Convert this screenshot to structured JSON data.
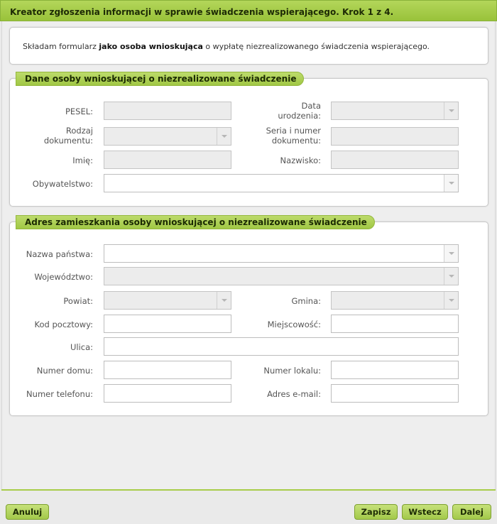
{
  "title": "Kreator zgłoszenia informacji w sprawie świadczenia wspierającego. Krok 1 z 4.",
  "intro": {
    "prefix": "Składam formularz ",
    "bold": "jako osoba wnioskująca",
    "suffix": " o wypłatę niezrealizowanego świadczenia wspierającego."
  },
  "section_person": {
    "legend": "Dane osoby wnioskującej o niezrealizowane świadczenie",
    "pesel": {
      "label": "PESEL:",
      "value": ""
    },
    "birth_date": {
      "label_line1": "Data",
      "label_line2": "urodzenia:",
      "value": ""
    },
    "doc_type": {
      "label_line1": "Rodzaj",
      "label_line2": "dokumentu:",
      "value": ""
    },
    "doc_number": {
      "label_line1": "Seria i numer",
      "label_line2": "dokumentu:",
      "value": ""
    },
    "first_name": {
      "label": "Imię:",
      "value": ""
    },
    "last_name": {
      "label": "Nazwisko:",
      "value": ""
    },
    "citizenship": {
      "label": "Obywatelstwo:",
      "value": ""
    }
  },
  "section_address": {
    "legend": "Adres zamieszkania osoby wnioskującej o niezrealizowane świadczenie",
    "country": {
      "label": "Nazwa państwa:",
      "value": ""
    },
    "voivodeship": {
      "label": "Województwo:",
      "value": ""
    },
    "county": {
      "label": "Powiat:",
      "value": ""
    },
    "commune": {
      "label": "Gmina:",
      "value": ""
    },
    "postal_code": {
      "label": "Kod pocztowy:",
      "value": ""
    },
    "city": {
      "label": "Miejscowość:",
      "value": ""
    },
    "street": {
      "label": "Ulica:",
      "value": ""
    },
    "house_number": {
      "label": "Numer domu:",
      "value": ""
    },
    "apartment_number": {
      "label": "Numer lokalu:",
      "value": ""
    },
    "phone": {
      "label": "Numer telefonu:",
      "value": ""
    },
    "email": {
      "label": "Adres e-mail:",
      "value": ""
    }
  },
  "buttons": {
    "cancel": "Anuluj",
    "save": "Zapisz",
    "back": "Wstecz",
    "next": "Dalej"
  },
  "colors": {
    "accent": "#a3c94a",
    "accent_border": "#7ea12f"
  }
}
